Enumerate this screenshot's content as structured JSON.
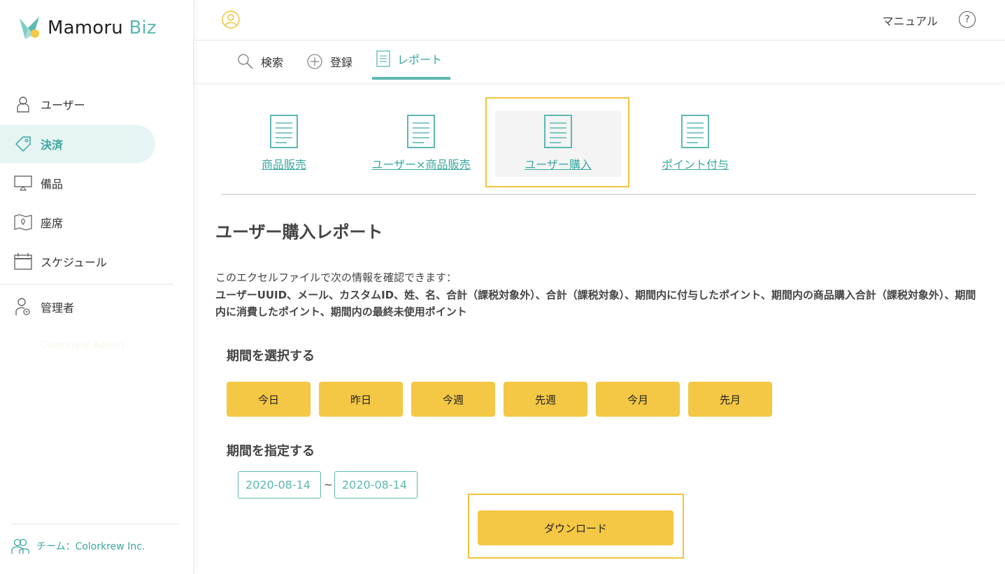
{
  "brand": {
    "name_main": "Mamoru",
    "name_accent": "Biz"
  },
  "sidebar": {
    "items": [
      {
        "label": "ユーザー",
        "icon": "user-icon"
      },
      {
        "label": "決済",
        "icon": "tag-icon",
        "active": true
      },
      {
        "label": "備品",
        "icon": "monitor-icon"
      },
      {
        "label": "座席",
        "icon": "map-pin-icon"
      },
      {
        "label": "スケジュール",
        "icon": "calendar-icon"
      },
      {
        "label": "管理者",
        "icon": "admin-user-icon"
      }
    ],
    "hidden_text": "Colorkrew Admin",
    "team_label": "チーム：Colorkrew Inc."
  },
  "header": {
    "manual_label": "マニュアル",
    "help_symbol": "?"
  },
  "tabs": [
    {
      "label": "検索",
      "icon": "search-icon"
    },
    {
      "label": "登録",
      "icon": "plus-circle-icon"
    },
    {
      "label": "レポート",
      "icon": "document-icon",
      "active": true
    }
  ],
  "report_types": [
    {
      "label": "商品販売"
    },
    {
      "label": "ユーザー×商品販売"
    },
    {
      "label": "ユーザー購入",
      "selected": true
    },
    {
      "label": "ポイント付与"
    }
  ],
  "main": {
    "title": "ユーザー購入レポート",
    "description_intro": "このエクセルファイルで次の情報を確認できます：",
    "description_fields": "ユーザーUUID、メール、カスタムID、姓、名、合計（課税対象外）、合計（課税対象）、期間内に付与したポイント、期間内の商品購入合計（課税対象外）、期間内に消費したポイント、期間内の最終未使用ポイント",
    "select_period_title": "期間を選択する",
    "period_buttons": [
      "今日",
      "昨日",
      "今週",
      "先週",
      "今月",
      "先月"
    ],
    "specify_period_title": "期間を指定する",
    "date_from": "2020-08-14",
    "date_separator": "~",
    "date_to": "2020-08-14",
    "download_label": "ダウンロード"
  },
  "colors": {
    "accent_teal": "#5cb8b2",
    "accent_yellow": "#f4c745",
    "highlight_frame": "#f0c33c"
  }
}
